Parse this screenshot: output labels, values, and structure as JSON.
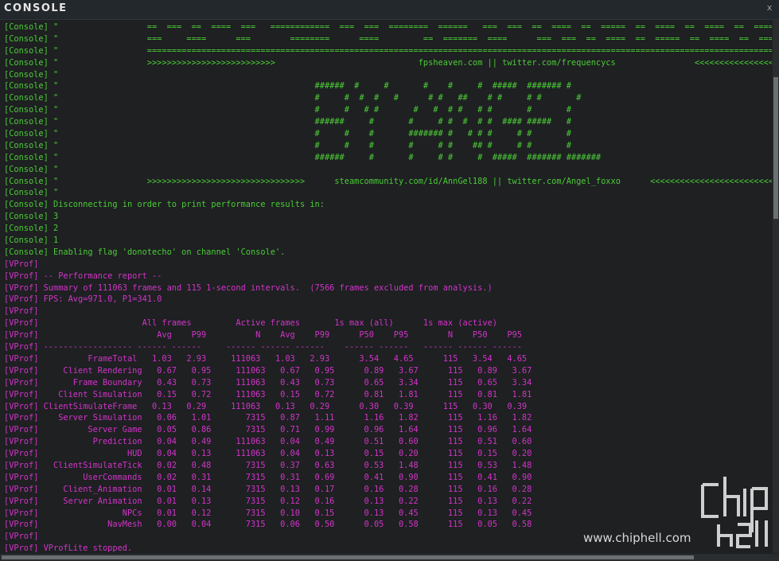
{
  "window": {
    "title": "CONSOLE",
    "close_label": "x"
  },
  "colors": {
    "console_tag": "#4ccb37",
    "vprof_tag": "#d234c8",
    "background": "#1e2022"
  },
  "lines": [
    {
      "c": "green",
      "t": "[Console] \"                  ==  ===  ==  ====  ===   ============  ===  ===  ========  ======   ===  ===  ==  ====  ==  =====  ==  ====  ==  ====  ==  ====  ="
    },
    {
      "c": "green",
      "t": "[Console] \"                  ===     ====      ===        ========      ====         ==  =======  ====      ===  ===  ==  ====  ==  =====  ==  ====  ==  ====  ==  ====  ="
    },
    {
      "c": "green",
      "t": "[Console] \"                  ========================================================================================================================================"
    },
    {
      "c": "green",
      "t": "[Console] \"                  >>>>>>>>>>>>>>>>>>>>>>>>>>                             fpsheaven.com || twitter.com/frequencycs                <<<<<<<<<<<<<<<<<<<<<<<<<<"
    },
    {
      "c": "green",
      "t": "[Console] \""
    },
    {
      "c": "green",
      "t": "[Console] \"                                                    ######  #     #       #    #     #  #####  ####### #"
    },
    {
      "c": "green",
      "t": "[Console] \"                                                    #     #  #  #   #      # #   ##    # #     # #       #"
    },
    {
      "c": "green",
      "t": "[Console] \"                                                    #     #   # #       #   #  # #   # #       #       #"
    },
    {
      "c": "green",
      "t": "[Console] \"                                                    ######     #       #     # #  #  # #  #### #####   #"
    },
    {
      "c": "green",
      "t": "[Console] \"                                                    #     #    #       ####### #   # # #     # #       #"
    },
    {
      "c": "green",
      "t": "[Console] \"                                                    #     #    #       #     # #    ## #     # #       #"
    },
    {
      "c": "green",
      "t": "[Console] \"                                                    ######     #       #     # #     #  #####  ####### #######"
    },
    {
      "c": "green",
      "t": "[Console] \""
    },
    {
      "c": "green",
      "t": "[Console] \"                  >>>>>>>>>>>>>>>>>>>>>>>>>>>>>>>>      steamcommunity.com/id/AnnGel188 || twitter.com/Angel_foxxo      <<<<<<<<<<<<<<<<<<<<<<<<<<<<<<<<"
    },
    {
      "c": "green",
      "t": "[Console] \""
    },
    {
      "c": "green",
      "t": "[Console] Disconnecting in order to print performance results in:"
    },
    {
      "c": "green",
      "t": "[Console] 3"
    },
    {
      "c": "green",
      "t": "[Console] 2"
    },
    {
      "c": "green",
      "t": "[Console] 1"
    },
    {
      "c": "green",
      "t": "[Console] Enabling flag 'donotecho' on channel 'Console'."
    },
    {
      "c": "magenta",
      "t": "[VProf]"
    },
    {
      "c": "magenta",
      "t": "[VProf] -- Performance report --"
    },
    {
      "c": "magenta",
      "t": "[VProf] Summary of 111063 frames and 115 1-second intervals.  (7566 frames excluded from analysis.)"
    },
    {
      "c": "magenta",
      "t": "[VProf] FPS: Avg=971.0, P1=341.0"
    },
    {
      "c": "magenta",
      "t": "[VProf]"
    },
    {
      "c": "magenta",
      "t": "[VProf]                     All frames         Active frames       1s max (all)      1s max (active)"
    },
    {
      "c": "magenta",
      "t": "[VProf]                        Avg    P99          N    Avg    P99      P50    P95        N    P50    P95"
    },
    {
      "c": "magenta",
      "t": "[VProf] ------------------ ------ ------     ------ ------ ------    ------ ------   ------ ------ ------"
    },
    {
      "c": "magenta",
      "t": "[VProf]          FrameTotal   1.03   2.93     111063   1.03   2.93      3.54   4.65      115   3.54   4.65"
    },
    {
      "c": "magenta",
      "t": "[VProf]     Client Rendering   0.67   0.95     111063   0.67   0.95      0.89   3.67      115   0.89   3.67"
    },
    {
      "c": "magenta",
      "t": "[VProf]       Frame Boundary   0.43   0.73     111063   0.43   0.73      0.65   3.34      115   0.65   3.34"
    },
    {
      "c": "magenta",
      "t": "[VProf]    Client Simulation   0.15   0.72     111063   0.15   0.72      0.81   1.81      115   0.81   1.81"
    },
    {
      "c": "magenta",
      "t": "[VProf] ClientSimulateFrame   0.13   0.29     111063   0.13   0.29      0.30   0.39      115   0.30   0.39"
    },
    {
      "c": "magenta",
      "t": "[VProf]    Server Simulation   0.06   1.01       7315   0.87   1.11      1.16   1.82      115   1.16   1.82"
    },
    {
      "c": "magenta",
      "t": "[VProf]          Server Game   0.05   0.86       7315   0.71   0.99      0.96   1.64      115   0.96   1.64"
    },
    {
      "c": "magenta",
      "t": "[VProf]           Prediction   0.04   0.49     111063   0.04   0.49      0.51   0.60      115   0.51   0.60"
    },
    {
      "c": "magenta",
      "t": "[VProf]                  HUD   0.04   0.13     111063   0.04   0.13      0.15   0.20      115   0.15   0.20"
    },
    {
      "c": "magenta",
      "t": "[VProf]   ClientSimulateTick   0.02   0.48       7315   0.37   0.63      0.53   1.48      115   0.53   1.48"
    },
    {
      "c": "magenta",
      "t": "[VProf]         UserCommands   0.02   0.31       7315   0.31   0.69      0.41   0.90      115   0.41   0.90"
    },
    {
      "c": "magenta",
      "t": "[VProf]     Client_Animation   0.01   0.14       7315   0.13   0.17      0.16   0.28      115   0.16   0.28"
    },
    {
      "c": "magenta",
      "t": "[VProf]     Server Animation   0.01   0.13       7315   0.12   0.16      0.13   0.22      115   0.13   0.22"
    },
    {
      "c": "magenta",
      "t": "[VProf]                 NPCs   0.01   0.12       7315   0.10   0.15      0.13   0.45      115   0.13   0.45"
    },
    {
      "c": "magenta",
      "t": "[VProf]              NavMesh   0.00   0.04       7315   0.06   0.50      0.05   0.58      115   0.05   0.58"
    },
    {
      "c": "magenta",
      "t": "[VProf]"
    },
    {
      "c": "magenta",
      "t": "[VProf] VProfLite stopped."
    }
  ],
  "watermark": {
    "text": "www.chiphell.com",
    "logo_icon": "chiphell-logo-icon"
  }
}
